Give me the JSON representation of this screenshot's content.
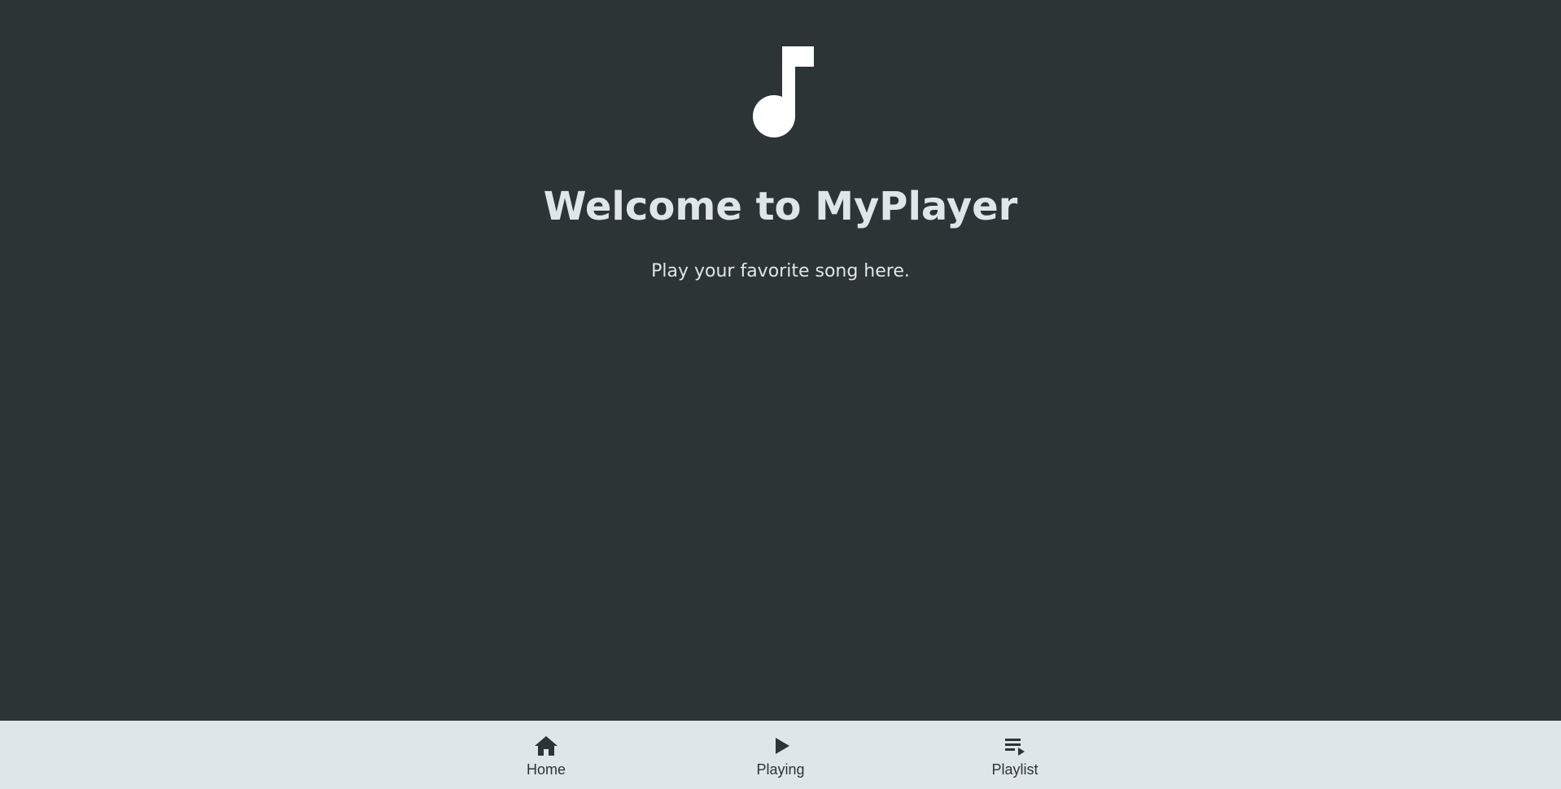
{
  "app": {
    "title": "Welcome to MyPlayer",
    "subtitle": "Play your favorite song here.",
    "logo_icon": "music-note-icon"
  },
  "nav": {
    "items": [
      {
        "label": "Home",
        "icon": "home-icon"
      },
      {
        "label": "Playing",
        "icon": "play-icon"
      },
      {
        "label": "Playlist",
        "icon": "playlist-play-icon"
      }
    ]
  },
  "colors": {
    "background": "#2d3436",
    "text": "#dfe6e9",
    "nav_background": "#dfe6e9",
    "nav_text": "#2d3436"
  }
}
